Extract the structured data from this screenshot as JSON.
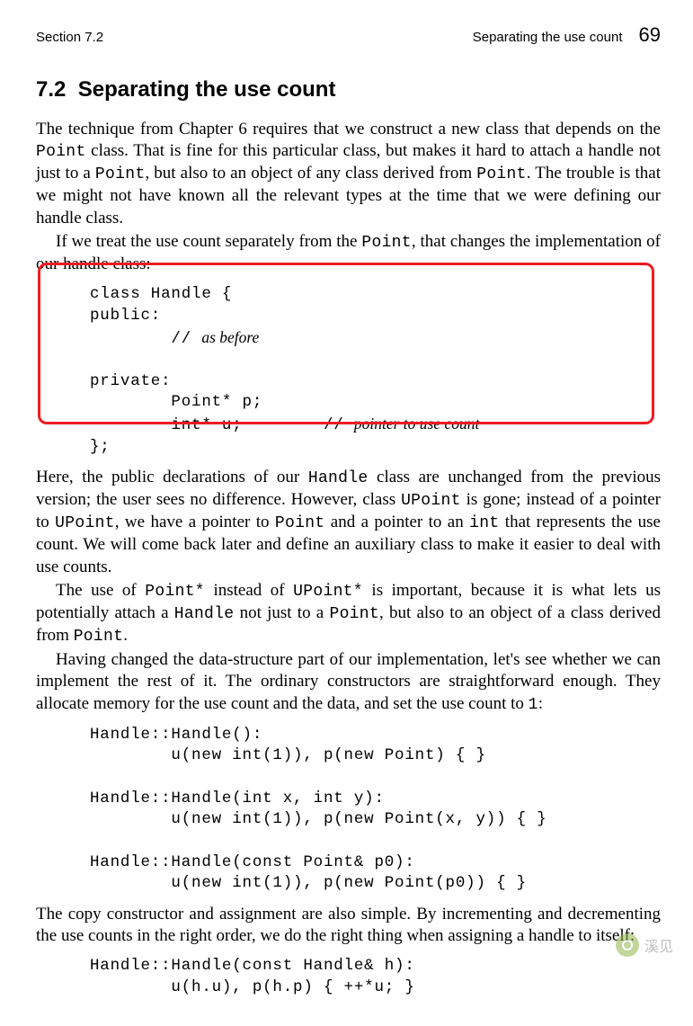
{
  "header": {
    "section_label": "Section 7.2",
    "chapter_label": "Separating the use count",
    "page_number": "69"
  },
  "title": {
    "number": "7.2",
    "text": "Separating the use count"
  },
  "inline": {
    "Point": "Point",
    "Handle": "Handle",
    "UPoint": "UPoint",
    "int": "int",
    "Pointstar": "Point*",
    "UPointstar": "UPoint*",
    "one": "1"
  },
  "para": {
    "p1a": "The technique from Chapter 6 requires that we construct a new class that depends on the ",
    "p1b": " class.  That is fine for this particular class, but makes it hard to attach a handle not just to a ",
    "p1c": ", but also to an object of any class derived from ",
    "p1d": ".  The trouble is that we might not have known all the relevant types at the time that we were defining our handle class.",
    "p2a": "If we treat the use count separately from the ",
    "p2b": ", that changes the implementation of our handle class:",
    "p3a": "Here, the public declarations of our ",
    "p3b": " class are unchanged from the previous version; the user sees no difference.  However, class ",
    "p3c": " is gone; instead of a pointer to ",
    "p3d": ", we have a pointer to ",
    "p3e": " and a pointer to an ",
    "p3f": " that represents the use count.  We will come back later and define an auxiliary class to make it easier to deal with use counts.",
    "p4a": "The use of ",
    "p4b": " instead of ",
    "p4c": " is important, because it is what lets us potentially attach a ",
    "p4d": " not just to a ",
    "p4e": ", but also to an object of a class derived from ",
    "p4f": ".",
    "p5a": "Having changed the data-structure part of our implementation, let's see whether we can implement the rest of it.  The ordinary constructors are straightforward enough.  They allocate memory for the use count and the data, and set the use count to ",
    "p5b": ":",
    "p6": "The copy constructor and assignment are also simple.  By incrementing and decrementing the use counts in the right order, we do the right thing when assigning a handle to itself:"
  },
  "code1": {
    "l1": "class Handle {",
    "l2": "public:",
    "l3_slashes": "// ",
    "l3_cmt": "as before",
    "l4": "private:",
    "l5": "        Point* p;",
    "l6a": "        int* u;",
    "l6_slashes": "// ",
    "l6_cmt": "pointer to use count",
    "l7": "};"
  },
  "code2": {
    "l1": "Handle::Handle():",
    "l2": "        u(new int(1)), p(new Point) { }",
    "l3": "Handle::Handle(int x, int y):",
    "l4": "        u(new int(1)), p(new Point(x, y)) { }",
    "l5": "Handle::Handle(const Point& p0):",
    "l6": "        u(new int(1)), p(new Point(p0)) { }"
  },
  "code3": {
    "l1": "Handle::Handle(const Handle& h):",
    "l2": "        u(h.u), p(h.p) { ++*u; }"
  },
  "highlight": {
    "left": "42",
    "top": "292",
    "width": "680",
    "height": "174"
  },
  "watermark": {
    "text": "溪见"
  }
}
